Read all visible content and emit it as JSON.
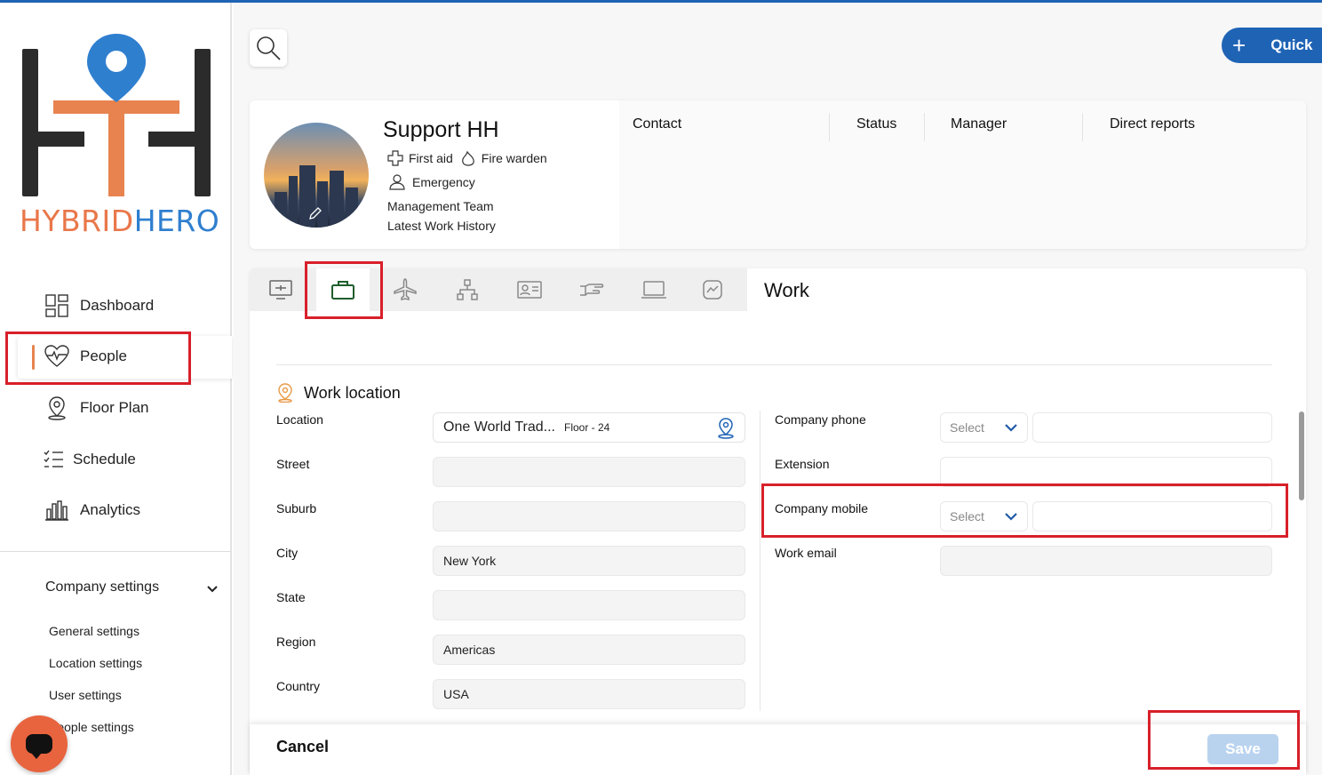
{
  "app": {
    "logo_text_left": "HYBRID",
    "logo_text_right": "HERO",
    "accent_color": "#1f63b5",
    "brand_orange": "#e8834f"
  },
  "sidebar": {
    "items": [
      {
        "label": "Dashboard",
        "icon": "dashboard-icon"
      },
      {
        "label": "People",
        "icon": "heart-pulse-icon",
        "active": true
      },
      {
        "label": "Floor Plan",
        "icon": "map-pin-icon"
      },
      {
        "label": "Schedule",
        "icon": "checklist-icon"
      },
      {
        "label": "Analytics",
        "icon": "bar-chart-icon"
      }
    ],
    "company_settings": {
      "label": "Company settings",
      "sub_items": [
        "General settings",
        "Location settings",
        "User settings",
        "People settings"
      ]
    }
  },
  "header": {
    "quick_label": "Quick"
  },
  "profile": {
    "name": "Support HH",
    "badges": [
      "First aid",
      "Fire warden"
    ],
    "emergency": "Emergency",
    "team": "Management Team",
    "history": "Latest Work History",
    "columns": [
      "Contact",
      "Status",
      "Manager",
      "Direct reports"
    ]
  },
  "tabs": [
    {
      "icon": "monitor-icon"
    },
    {
      "icon": "briefcase-icon",
      "active": true
    },
    {
      "icon": "plane-icon"
    },
    {
      "icon": "org-chart-icon"
    },
    {
      "icon": "id-card-icon"
    },
    {
      "icon": "hand-icon"
    },
    {
      "icon": "laptop-icon"
    },
    {
      "icon": "activity-icon"
    }
  ],
  "work": {
    "title": "Work",
    "section_title": "Work location",
    "left_fields": {
      "location": {
        "label": "Location",
        "value": "One World Trad...",
        "floor": "Floor - 24"
      },
      "street": {
        "label": "Street",
        "value": ""
      },
      "suburb": {
        "label": "Suburb",
        "value": ""
      },
      "city": {
        "label": "City",
        "value": "New York"
      },
      "state": {
        "label": "State",
        "value": ""
      },
      "region": {
        "label": "Region",
        "value": "Americas"
      },
      "country": {
        "label": "Country",
        "value": "USA"
      }
    },
    "right_fields": {
      "company_phone": {
        "label": "Company phone",
        "select": "Select",
        "value": ""
      },
      "extension": {
        "label": "Extension",
        "value": ""
      },
      "company_mobile": {
        "label": "Company mobile",
        "select": "Select",
        "value": ""
      },
      "work_email": {
        "label": "Work email",
        "value": ""
      }
    }
  },
  "footer": {
    "cancel_label": "Cancel",
    "save_label": "Save"
  }
}
